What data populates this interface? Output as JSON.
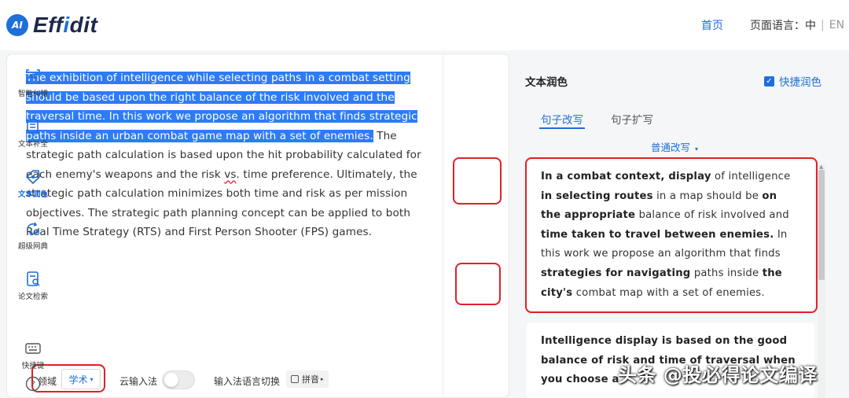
{
  "header": {
    "logo_badge": "AI",
    "logo_prefix": "Eff",
    "logo_mid": "i",
    "logo_suffix": "dit",
    "nav_home": "首页",
    "lang_label": "页面语言：",
    "lang_zh": "中",
    "lang_sep": "|",
    "lang_en": "EN"
  },
  "editor": {
    "highlighted_text": "The exhibition of intelligence while selecting paths in a combat setting should be based upon the right balance of the risk involved and the traversal time. In this work we propose an algorithm that finds strategic paths inside an urban combat game map with a set of enemies.",
    "text_part1": " The strategic path calculation is based upon the hit probability calculated for each enemy's weapons and the risk ",
    "text_underlined": "vs",
    "text_part2": ". time preference. Ultimately, the strategic path calculation minimizes both time and risk as per mission objectives. The strategic path planning concept can be applied to both Real Time Strategy (RTS) and First Person Shooter (FPS) games."
  },
  "bottom_bar": {
    "domain_label": "领域",
    "domain_value": "学术",
    "cloud_ime_label": "云输入法",
    "ime_switch_label": "输入法语言切换",
    "pinyin_label": "拼音"
  },
  "tools": [
    {
      "label": "智能纠错",
      "icon": "ab-check-icon"
    },
    {
      "label": "文本补全",
      "icon": "doc-complete-icon"
    },
    {
      "label": "文本润色",
      "icon": "polish-diamond-icon"
    },
    {
      "label": "超级网典",
      "icon": "sync-arrows-icon"
    },
    {
      "label": "论文检索",
      "icon": "doc-search-icon"
    },
    {
      "label": "快捷键",
      "icon": "keyboard-icon"
    },
    {
      "label": "?",
      "icon": "help-icon"
    }
  ],
  "panel": {
    "title": "文本润色",
    "quick_polish": "快捷润色",
    "tab_rewrite": "句子改写",
    "tab_expand": "句子扩写",
    "mode": "普通改写",
    "card1": [
      [
        [
          "b",
          "In a combat context, display"
        ],
        [
          "n",
          " of intelligence"
        ]
      ],
      [
        [
          "b",
          "in selecting routes"
        ],
        [
          "n",
          " in a map should be "
        ],
        [
          "b",
          "on"
        ]
      ],
      [
        [
          "b",
          "the appropriate"
        ],
        [
          "n",
          " balance of risk involved and"
        ]
      ],
      [
        [
          "b",
          "time taken to travel between enemies."
        ],
        [
          "n",
          " In"
        ]
      ],
      [
        [
          "n",
          "this work we propose an algorithm that finds"
        ]
      ],
      [
        [
          "b",
          "strategies for navigating"
        ],
        [
          "n",
          " paths inside "
        ],
        [
          "b",
          "the"
        ]
      ],
      [
        [
          "b",
          "city's"
        ],
        [
          "n",
          " combat map with a set of enemies."
        ]
      ]
    ],
    "card2": [
      "Intelligence display is based on the good",
      "balance of risk and time of traversal when",
      "you choose a"
    ]
  },
  "watermark": "头条 @投必得论文编译"
}
